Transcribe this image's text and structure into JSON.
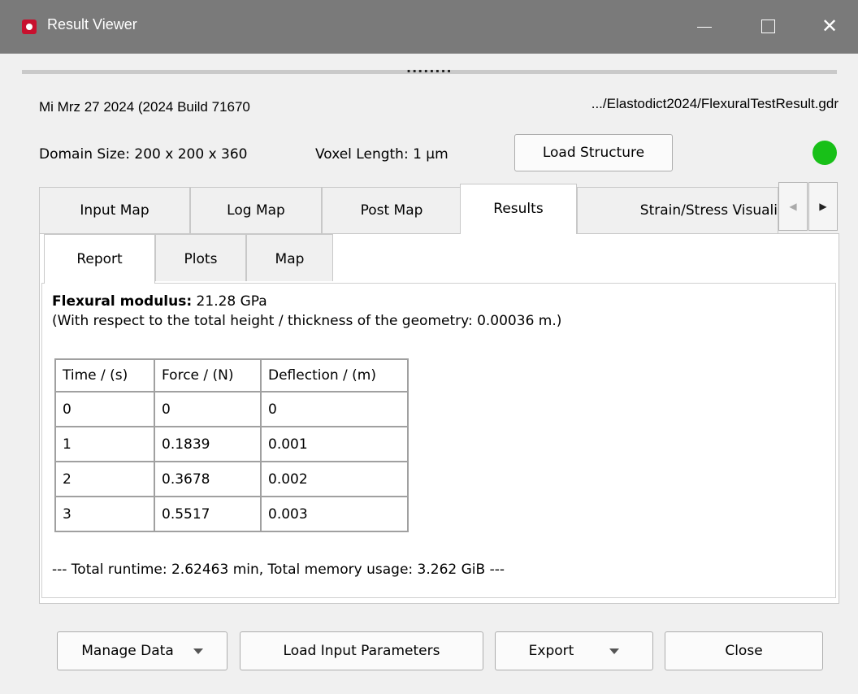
{
  "window": {
    "title": "Result Viewer",
    "close_glyph": "✕"
  },
  "splitter": {
    "handle": "........"
  },
  "header": {
    "date_build": "Mi Mrz 27 2024 (2024 Build 71670",
    "file_path": ".../Elastodict2024/FlexuralTestResult.gdr",
    "domain_size": "Domain Size: 200 x 200 x 360",
    "voxel_length": "Voxel Length: 1 µm",
    "load_structure_label": "Load Structure",
    "status_color": "#18c018"
  },
  "tabs": [
    {
      "label": "Input Map"
    },
    {
      "label": "Log Map"
    },
    {
      "label": "Post Map"
    },
    {
      "label": "Results"
    },
    {
      "label": "Strain/Stress Visuali"
    }
  ],
  "tab_scroll": {
    "left_glyph": "◀",
    "right_glyph": "▶"
  },
  "subtabs": [
    {
      "label": "Report"
    },
    {
      "label": "Plots"
    },
    {
      "label": "Map"
    }
  ],
  "report": {
    "modulus_label": "Flexural modulus:",
    "modulus_value": " 21.28 GPa",
    "respect_note": "(With respect to the total height / thickness of the geometry: 0.00036 m.)",
    "table": {
      "headers": [
        "Time / (s)",
        "Force / (N)",
        "Deflection / (m)"
      ],
      "rows": [
        [
          "0",
          "0",
          "0"
        ],
        [
          "1",
          "0.1839",
          "0.001"
        ],
        [
          "2",
          "0.3678",
          "0.002"
        ],
        [
          "3",
          "0.5517",
          "0.003"
        ]
      ]
    },
    "runtime": "--- Total runtime: 2.62463 min, Total memory usage: 3.262 GiB ---"
  },
  "footer": {
    "manage_data": "Manage Data",
    "load_input_parameters": "Load Input Parameters",
    "export": "Export",
    "close": "Close"
  }
}
